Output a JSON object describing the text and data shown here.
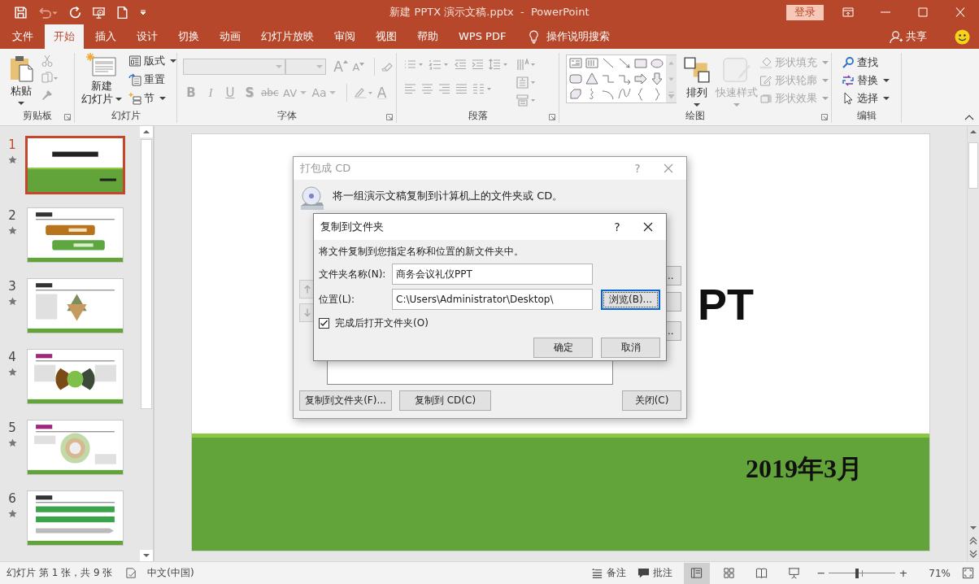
{
  "window": {
    "title": "新建 PPTX 演示文稿.pptx  -  PowerPoint",
    "login": "登录",
    "undo_disabled": true
  },
  "tabs": [
    {
      "label": "文件",
      "selected": false
    },
    {
      "label": "开始",
      "selected": true
    },
    {
      "label": "插入",
      "selected": false
    },
    {
      "label": "设计",
      "selected": false
    },
    {
      "label": "切换",
      "selected": false
    },
    {
      "label": "动画",
      "selected": false
    },
    {
      "label": "幻灯片放映",
      "selected": false
    },
    {
      "label": "审阅",
      "selected": false
    },
    {
      "label": "视图",
      "selected": false
    },
    {
      "label": "帮助",
      "selected": false
    },
    {
      "label": "WPS PDF",
      "selected": false
    }
  ],
  "tell_me": "操作说明搜索",
  "share": "共享",
  "ribbon": {
    "clipboard": {
      "label": "剪贴板",
      "paste": "粘贴",
      "tools_disabled": true
    },
    "slides": {
      "label": "幻灯片",
      "new_slide": [
        "新建",
        "幻灯片"
      ],
      "items": [
        {
          "kind": "layout",
          "label": "版式",
          "dropdown": true
        },
        {
          "kind": "reset",
          "label": "重置",
          "dropdown": false
        },
        {
          "kind": "section",
          "label": "节",
          "dropdown": true
        }
      ]
    },
    "font": {
      "label": "字体",
      "disabled": true,
      "grow": "A",
      "shrink": "A",
      "font_color": "A",
      "format_buttons": [
        {
          "kind": "bold",
          "label": "B",
          "dropdown": false
        },
        {
          "kind": "italic",
          "label": "I",
          "dropdown": false
        },
        {
          "kind": "underline",
          "label": "U",
          "dropdown": false
        },
        {
          "kind": "shadow",
          "label": "S",
          "dropdown": false
        },
        {
          "kind": "strike",
          "label": "abc",
          "dropdown": false
        },
        {
          "kind": "spacing",
          "label": "AV",
          "dropdown": true
        },
        {
          "kind": "case",
          "label": "Aa",
          "dropdown": true
        }
      ]
    },
    "paragraph": {
      "label": "段落",
      "disabled": true
    },
    "drawing": {
      "label": "绘图",
      "arrange": "排列",
      "quick_styles": {
        "label": "快速样式",
        "disabled": true
      },
      "commands": [
        {
          "kind": "fill",
          "label": "形状填充",
          "disabled": true
        },
        {
          "kind": "outline",
          "label": "形状轮廓",
          "disabled": true
        },
        {
          "kind": "effects",
          "label": "形状效果",
          "disabled": true
        }
      ]
    },
    "editing": {
      "label": "编辑",
      "commands": [
        {
          "kind": "find",
          "label": "查找",
          "dropdown": false
        },
        {
          "kind": "replace",
          "label": "替换",
          "dropdown": true
        },
        {
          "kind": "select",
          "label": "选择",
          "dropdown": true
        }
      ]
    }
  },
  "slides": [
    {
      "number": "1",
      "selected": true,
      "animated": true,
      "kind": "title"
    },
    {
      "number": "2",
      "selected": false,
      "animated": true,
      "kind": "agenda"
    },
    {
      "number": "3",
      "selected": false,
      "animated": true,
      "kind": "triangles"
    },
    {
      "number": "4",
      "selected": false,
      "animated": true,
      "kind": "hub"
    },
    {
      "number": "5",
      "selected": false,
      "animated": true,
      "kind": "ring"
    },
    {
      "number": "6",
      "selected": false,
      "animated": true,
      "kind": "flow"
    }
  ],
  "slide": {
    "title_visible": "PT",
    "date": "2019年3月"
  },
  "package_dialog": {
    "title": "打包成 CD",
    "active": false,
    "help": "?",
    "description": "将一组演示文稿复制到计算机上的文件夹或 CD。",
    "side_buttons": [
      "..",
      ".."
    ],
    "buttons": [
      "复制到文件夹(F)...",
      "复制到 CD(C)",
      "关闭(C)"
    ]
  },
  "copy_dialog": {
    "title": "复制到文件夹",
    "help": "?",
    "instruction": "将文件复制到您指定名称和位置的新文件夹中。",
    "fields": [
      {
        "label": "文件夹名称(N):",
        "value": "商务会议礼仪PPT"
      },
      {
        "label": "位置(L):",
        "value": "C:\\Users\\Administrator\\Desktop\\"
      }
    ],
    "browse": {
      "label": "浏览(B)...",
      "focused": true
    },
    "open_folder": {
      "label": "完成后打开文件夹(O)",
      "checked": true
    },
    "buttons": [
      "确定",
      "取消"
    ]
  },
  "status_bar": {
    "slide_info": "幻灯片 第 1 张，共 9 张",
    "language": "中文(中国)",
    "notes": "备注",
    "comments": "批注",
    "views": [
      {
        "kind": "normal",
        "selected": true
      },
      {
        "kind": "sorter",
        "selected": false
      },
      {
        "kind": "reading",
        "selected": false
      },
      {
        "kind": "show",
        "selected": false
      }
    ],
    "zoom": {
      "minus": "−",
      "plus": "+",
      "level": 0.42,
      "reading": "71%"
    }
  }
}
